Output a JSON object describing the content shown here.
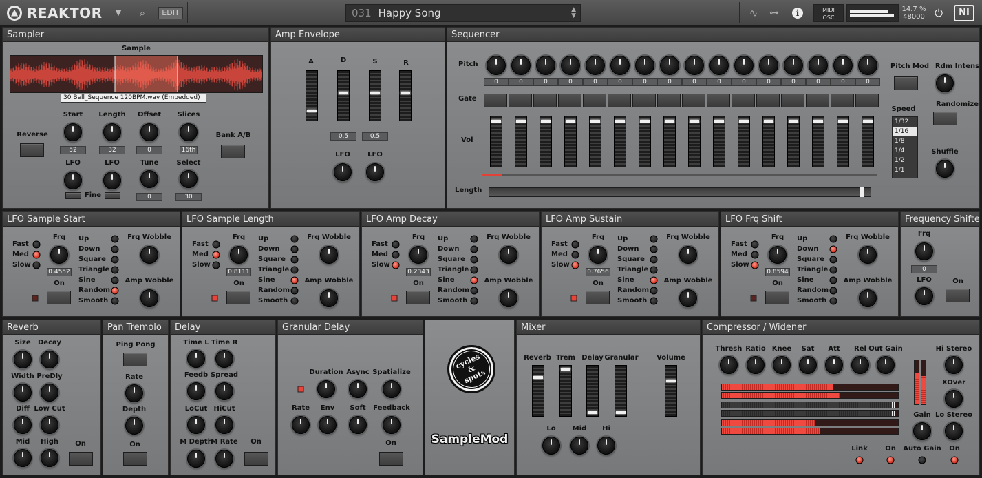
{
  "topbar": {
    "app_name": "REAKTOR",
    "edit_label": "EDIT",
    "snapshot_number": "031",
    "snapshot_name": "Happy Song",
    "midi_label": "MIDI",
    "osc_label": "OSC",
    "cpu_percent": "14.7 %",
    "sample_rate": "48000",
    "ni_label": "NI"
  },
  "sampler": {
    "title": "Sampler",
    "sample_label": "Sample",
    "sample_file": "30 Bell_Sequence 120BPM.wav (Embedded)",
    "reverse_label": "Reverse",
    "start_label": "Start",
    "start_value": "52",
    "length_label": "Length",
    "length_value": "32",
    "offset_label": "Offset",
    "offset_value": "0",
    "slices_label": "Slices",
    "slices_value": "16th",
    "bank_label": "Bank A/B",
    "lfo1_label": "LFO",
    "lfo2_label": "LFO",
    "fine_label": "Fine",
    "tune_label": "Tune",
    "tune_value": "0",
    "select_label": "Select",
    "select_value": "30"
  },
  "amp_envelope": {
    "title": "Amp Envelope",
    "a_label": "A",
    "d_label": "D",
    "s_label": "S",
    "r_label": "R",
    "d_value": "0.5",
    "s_value": "0.5",
    "lfo1_label": "LFO",
    "lfo2_label": "LFO",
    "a_level": 0.15,
    "d_level": 0.55,
    "s_level": 0.55,
    "r_level": 0.55
  },
  "sequencer": {
    "title": "Sequencer",
    "pitch_label": "Pitch",
    "gate_label": "Gate",
    "vol_label": "Vol",
    "length_label": "Length",
    "pitch_values": [
      "0",
      "0",
      "0",
      "0",
      "0",
      "0",
      "0",
      "0",
      "0",
      "0",
      "0",
      "0",
      "0",
      "0",
      "0",
      "0"
    ],
    "pitch_mod_label": "Pitch Mod",
    "rdm_intens_label": "Rdm Intens",
    "randomize_label": "Randomize",
    "speed_label": "Speed",
    "speed_options": [
      "1/32",
      "1/16",
      "1/8",
      "1/4",
      "1/2",
      "1/1"
    ],
    "speed_selected": "1/16",
    "shuffle_label": "Shuffle",
    "vol_level": 0.93,
    "length_position": 0.98,
    "step_position": 0.05
  },
  "lfo_common": {
    "frq_label": "Frq",
    "on_label": "On",
    "fast_label": "Fast",
    "med_label": "Med",
    "slow_label": "Slow",
    "shapes": [
      "Up",
      "Down",
      "Square",
      "Triangle",
      "Sine",
      "Random",
      "Smooth"
    ],
    "frq_wobble_label": "Frq Wobble",
    "amp_wobble_label": "Amp Wobble"
  },
  "lfos": [
    {
      "title": "LFO Sample Start",
      "frq_value": "0.4552",
      "speed": "Med",
      "shape": "Random",
      "on": false
    },
    {
      "title": "LFO Sample Length",
      "frq_value": "0.8111",
      "speed": "Med",
      "shape": "Sine",
      "on": true
    },
    {
      "title": "LFO Amp Decay",
      "frq_value": "0.2343",
      "speed": "Slow",
      "shape": "Sine",
      "on": true
    },
    {
      "title": "LFO Amp Sustain",
      "frq_value": "0.7656",
      "speed": "Slow",
      "shape": "Sine",
      "on": true
    },
    {
      "title": "LFO Frq Shift",
      "frq_value": "0.8594",
      "speed": "Slow",
      "shape": "Down",
      "on": false
    }
  ],
  "frequency_shifter": {
    "title": "Frequency Shifter",
    "frq_label": "Frq",
    "frq_value": "0",
    "lfo_label": "LFO",
    "on_label": "On"
  },
  "reverb": {
    "title": "Reverb",
    "size_label": "Size",
    "decay_label": "Decay",
    "width_label": "Width",
    "predly_label": "PreDly",
    "diff_label": "Diff",
    "lowcut_label": "Low Cut",
    "mid_label": "Mid",
    "high_label": "High",
    "on_label": "On"
  },
  "pan_tremolo": {
    "title": "Pan Tremolo",
    "pingpong_label": "Ping Pong",
    "rate_label": "Rate",
    "depth_label": "Depth",
    "on_label": "On"
  },
  "delay": {
    "title": "Delay",
    "timel_label": "Time L",
    "timer_label": "Time R",
    "feedb_label": "Feedb",
    "spread_label": "Spread",
    "locut_label": "LoCut",
    "hicut_label": "HiCut",
    "mdepth_label": "M Depth",
    "mrate_label": "M Rate",
    "on_label": "On"
  },
  "granular_delay": {
    "title": "Granular Delay",
    "duration_label": "Duration",
    "async_label": "Async",
    "spatialize_label": "Spatialize",
    "rate_label": "Rate",
    "env_label": "Env",
    "soft_label": "Soft",
    "feedback_label": "Feedback",
    "on_label": "On"
  },
  "branding": {
    "logo_line1": "cycles",
    "logo_line2": "&",
    "logo_line3": "spots",
    "product_name": "SampleMod"
  },
  "mixer": {
    "title": "Mixer",
    "reverb_label": "Reverb",
    "trem_label": "Trem",
    "delay_label": "Delay",
    "granular_label": "Granular",
    "volume_label": "Volume",
    "lo_label": "Lo",
    "mid_label": "Mid",
    "hi_label": "Hi",
    "reverb_level": 0.78,
    "trem_level": 0.95,
    "delay_level": 0.02,
    "granular_level": 0.02,
    "volume_level": 0.7
  },
  "compressor": {
    "title": "Compressor / Widener",
    "thresh_label": "Thresh",
    "ratio_label": "Ratio",
    "knee_label": "Knee",
    "sat_label": "Sat",
    "att_label": "Att",
    "rel_label": "Rel",
    "outgain_label": "Out Gain",
    "histereo_label": "Hi Stereo",
    "xover_label": "XOver",
    "gain_label": "Gain",
    "lostereo_label": "Lo Stereo",
    "link_label": "Link",
    "on_label": "On",
    "autogain_label": "Auto Gain",
    "on2_label": "On",
    "meter_levels": [
      0.63,
      0.67,
      0.98,
      0.98,
      0.53,
      0.56
    ]
  },
  "colors": {
    "accent_red": "#e9443a",
    "panel": "#7e8081",
    "header": "#3c3c3c"
  }
}
